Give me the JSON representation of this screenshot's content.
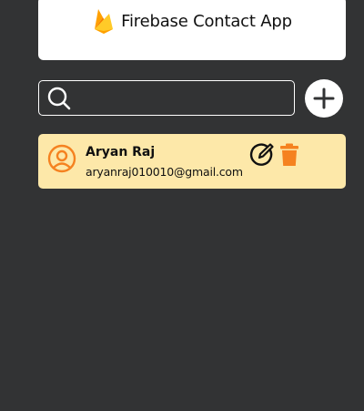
{
  "app": {
    "title": "Firebase Contact App",
    "logo_icon": "firebase-flame-icon"
  },
  "search": {
    "placeholder": "",
    "value": "",
    "icon": "search-icon"
  },
  "add_button": {
    "icon": "plus-icon"
  },
  "contacts": [
    {
      "name": "Aryan Raj",
      "email": "aryanraj010010@gmail.com",
      "avatar_icon": "user-circle-icon",
      "edit_icon": "edit-icon",
      "delete_icon": "trash-icon"
    }
  ],
  "colors": {
    "background": "#323334",
    "card": "#fde8a9",
    "accent": "#f58220",
    "white": "#ffffff"
  }
}
